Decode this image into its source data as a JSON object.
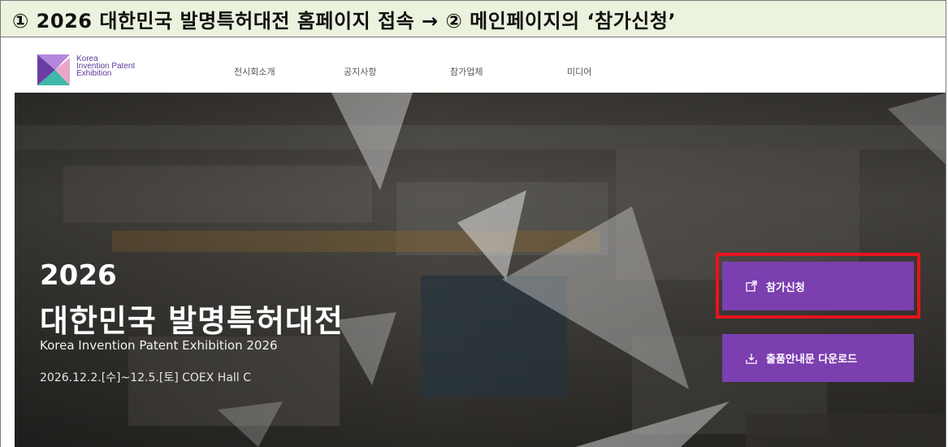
{
  "instruction": {
    "text": "① 2026 대한민국 발명특허대전 홈페이지 접속 → ② 메인페이지의 ‘참가신청’"
  },
  "header": {
    "logo_lines": [
      "Korea",
      "Invention Patent",
      "Exhibition"
    ],
    "menu": [
      "전시회소개",
      "공지사항",
      "참가업체",
      "미디어"
    ]
  },
  "hero": {
    "year": "2026",
    "title": "대한민국 발명특허대전",
    "subtitle": "Korea Invention Patent Exhibition 2026",
    "date": "2026.12.2.[수]~12.5.[토] COEX Hall C"
  },
  "buttons": {
    "apply_label": "참가신청",
    "download_label": "출품안내문 다운로드"
  },
  "colors": {
    "accent": "#7b3fb0",
    "highlight": "#e6141c",
    "instruction_bg": "#ebf2dd"
  },
  "icons": {
    "apply": "external-edit-icon",
    "download": "download-icon"
  }
}
